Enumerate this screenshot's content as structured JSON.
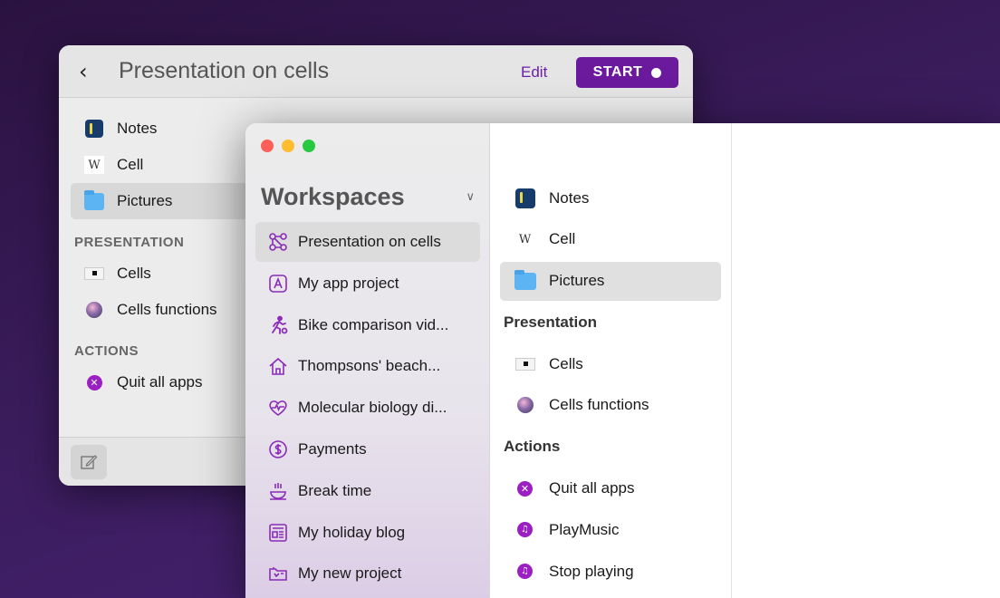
{
  "back_window": {
    "title": "Presentation on cells",
    "back_icon": "chevron-left-icon",
    "edit_label": "Edit",
    "start_label": "START",
    "items": [
      {
        "label": "Notes",
        "icon": "notes-app-icon"
      },
      {
        "label": "Cell",
        "icon": "wikipedia-icon",
        "icon_text": "W"
      },
      {
        "label": "Pictures",
        "icon": "folder-icon"
      }
    ],
    "section_presentation": "PRESENTATION",
    "presentation_items": [
      {
        "label": "Cells",
        "icon": "slide-icon"
      },
      {
        "label": "Cells functions",
        "icon": "image-thumbnail-icon"
      }
    ],
    "section_actions": "ACTIONS",
    "action_items": [
      {
        "label": "Quit all apps",
        "icon": "quit-icon"
      }
    ],
    "compose_icon": "compose-icon"
  },
  "front_window": {
    "workspaces_title": "Workspaces",
    "workspaces_chevron": "chevron-down-icon",
    "workspaces": [
      {
        "label": "Presentation on cells",
        "icon": "molecule-icon"
      },
      {
        "label": "My app project",
        "icon": "letter-a-icon"
      },
      {
        "label": "Bike comparison vid...",
        "icon": "runner-icon"
      },
      {
        "label": "Thompsons' beach...",
        "icon": "house-icon"
      },
      {
        "label": "Molecular biology di...",
        "icon": "heartbeat-icon"
      },
      {
        "label": "Payments",
        "icon": "dollar-icon"
      },
      {
        "label": "Break time",
        "icon": "coffee-icon"
      },
      {
        "label": "My holiday blog",
        "icon": "newspaper-icon"
      },
      {
        "label": "My new project",
        "icon": "folder-open-icon"
      }
    ],
    "items": [
      {
        "label": "Notes",
        "icon": "notes-app-icon"
      },
      {
        "label": "Cell",
        "icon": "wikipedia-icon",
        "icon_text": "W"
      },
      {
        "label": "Pictures",
        "icon": "folder-icon"
      }
    ],
    "section_presentation": "Presentation",
    "presentation_items": [
      {
        "label": "Cells",
        "icon": "slide-icon"
      },
      {
        "label": "Cells functions",
        "icon": "image-thumbnail-icon"
      }
    ],
    "section_actions": "Actions",
    "action_items": [
      {
        "label": "Quit all apps",
        "icon": "quit-icon"
      },
      {
        "label": "PlayMusic",
        "icon": "music-note-icon"
      },
      {
        "label": "Stop playing",
        "icon": "music-note-icon"
      }
    ]
  },
  "colors": {
    "accent": "#6b1a9e",
    "icon_purple": "#9b1fc2",
    "folder_blue": "#5cb5f2"
  }
}
